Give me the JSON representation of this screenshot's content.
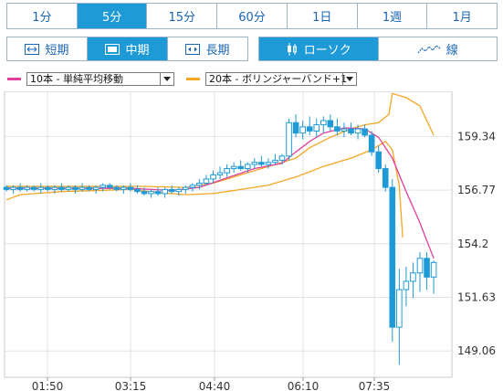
{
  "timeframes": [
    {
      "label": "1分",
      "active": false
    },
    {
      "label": "5分",
      "active": true
    },
    {
      "label": "15分",
      "active": false
    },
    {
      "label": "60分",
      "active": false
    },
    {
      "label": "1日",
      "active": false
    },
    {
      "label": "1週",
      "active": false
    },
    {
      "label": "1月",
      "active": false
    }
  ],
  "period_buttons": [
    {
      "label": "短期",
      "icon": "short-range-icon",
      "active": false
    },
    {
      "label": "中期",
      "icon": "mid-range-icon",
      "active": true
    },
    {
      "label": "長期",
      "icon": "long-range-icon",
      "active": false
    }
  ],
  "type_buttons": [
    {
      "label": "ローソク",
      "icon": "candlestick-icon",
      "active": true
    },
    {
      "label": "線",
      "icon": "line-chart-icon",
      "active": false
    }
  ],
  "indicators": [
    {
      "label": "10本 - 単純平均移動",
      "color": "#e0409a"
    },
    {
      "label": "20本 - ボリンジャーバンド+1",
      "color": "#f5a623"
    }
  ],
  "colors": {
    "accent": "#1e9ad6",
    "candle": "#1e9ad6",
    "ma": "#e0409a",
    "bollinger": "#f5a623"
  },
  "chart_data": {
    "type": "candlestick",
    "y_ticks": [
      159.34,
      156.77,
      154.2,
      151.63,
      149.06
    ],
    "ylim": [
      147.8,
      161.5
    ],
    "x_ticks": [
      "01:50",
      "03:15",
      "04:40",
      "06:10",
      "07:35"
    ],
    "grid": true,
    "candles": [
      [
        156.9,
        157.0,
        156.7,
        156.8
      ],
      [
        156.8,
        157.0,
        156.6,
        156.9
      ],
      [
        156.9,
        157.1,
        156.7,
        156.8
      ],
      [
        156.8,
        157.0,
        156.7,
        156.9
      ],
      [
        156.9,
        157.0,
        156.7,
        156.8
      ],
      [
        156.8,
        157.1,
        156.6,
        156.9
      ],
      [
        156.9,
        157.0,
        156.7,
        156.8
      ],
      [
        156.8,
        157.0,
        156.6,
        156.9
      ],
      [
        156.9,
        157.1,
        156.7,
        156.8
      ],
      [
        156.8,
        157.0,
        156.7,
        156.9
      ],
      [
        156.9,
        157.0,
        156.6,
        156.8
      ],
      [
        156.8,
        157.1,
        156.7,
        156.9
      ],
      [
        156.9,
        157.0,
        156.7,
        156.8
      ],
      [
        156.8,
        157.0,
        156.6,
        156.9
      ],
      [
        156.9,
        157.1,
        156.7,
        157.0
      ],
      [
        157.0,
        157.1,
        156.8,
        156.9
      ],
      [
        156.9,
        157.0,
        156.7,
        156.8
      ],
      [
        156.8,
        157.0,
        156.6,
        156.9
      ],
      [
        156.9,
        157.1,
        156.7,
        156.8
      ],
      [
        156.8,
        157.0,
        156.6,
        156.7
      ],
      [
        156.7,
        156.9,
        156.5,
        156.6
      ],
      [
        156.6,
        156.8,
        156.4,
        156.7
      ],
      [
        156.7,
        156.9,
        156.5,
        156.6
      ],
      [
        156.6,
        156.9,
        156.4,
        156.8
      ],
      [
        156.8,
        157.0,
        156.6,
        156.7
      ],
      [
        156.7,
        156.9,
        156.5,
        156.8
      ],
      [
        156.8,
        157.0,
        156.6,
        156.9
      ],
      [
        156.9,
        157.1,
        156.7,
        157.0
      ],
      [
        157.0,
        157.3,
        156.8,
        157.1
      ],
      [
        157.1,
        157.5,
        157.0,
        157.3
      ],
      [
        157.3,
        157.7,
        157.1,
        157.5
      ],
      [
        157.5,
        157.9,
        157.3,
        157.6
      ],
      [
        157.6,
        158.0,
        157.4,
        157.8
      ],
      [
        157.8,
        158.1,
        157.6,
        157.9
      ],
      [
        157.9,
        158.2,
        157.7,
        157.8
      ],
      [
        157.8,
        158.1,
        157.6,
        158.0
      ],
      [
        158.0,
        158.3,
        157.8,
        158.1
      ],
      [
        158.1,
        158.4,
        157.9,
        158.0
      ],
      [
        158.0,
        158.3,
        157.8,
        158.1
      ],
      [
        158.1,
        158.5,
        158.0,
        158.2
      ],
      [
        158.2,
        158.5,
        158.0,
        158.4
      ],
      [
        158.4,
        160.2,
        158.2,
        160.0
      ],
      [
        160.0,
        160.4,
        159.3,
        159.5
      ],
      [
        159.5,
        160.1,
        159.2,
        159.8
      ],
      [
        159.8,
        160.3,
        159.4,
        159.6
      ],
      [
        159.6,
        160.2,
        159.3,
        159.9
      ],
      [
        159.9,
        160.3,
        159.5,
        160.1
      ],
      [
        160.1,
        160.4,
        159.6,
        159.8
      ],
      [
        159.8,
        160.2,
        159.4,
        159.6
      ],
      [
        159.6,
        160.0,
        159.3,
        159.7
      ],
      [
        159.7,
        160.0,
        159.4,
        159.5
      ],
      [
        159.5,
        159.9,
        159.2,
        159.7
      ],
      [
        159.7,
        159.9,
        159.3,
        159.4
      ],
      [
        159.4,
        159.6,
        158.4,
        158.6
      ],
      [
        158.6,
        158.9,
        157.6,
        157.8
      ],
      [
        157.8,
        158.0,
        156.7,
        156.9
      ],
      [
        156.9,
        157.3,
        149.5,
        150.2
      ],
      [
        150.2,
        153.0,
        148.4,
        152.0
      ],
      [
        152.0,
        153.1,
        151.2,
        152.4
      ],
      [
        152.4,
        153.3,
        151.6,
        152.8
      ],
      [
        152.8,
        153.8,
        151.9,
        153.5
      ],
      [
        153.5,
        153.8,
        152.0,
        152.6
      ],
      [
        152.6,
        153.4,
        151.8,
        153.3
      ]
    ],
    "ma_10": [
      [
        0,
        156.85
      ],
      [
        18,
        156.85
      ],
      [
        24,
        156.75
      ],
      [
        28,
        156.9
      ],
      [
        32,
        157.35
      ],
      [
        36,
        157.8
      ],
      [
        40,
        158.05
      ],
      [
        42,
        158.6
      ],
      [
        44,
        159.1
      ],
      [
        46,
        159.5
      ],
      [
        49,
        159.75
      ],
      [
        52,
        159.7
      ],
      [
        54,
        159.3
      ],
      [
        56,
        158.3
      ],
      [
        58,
        156.7
      ],
      [
        60,
        155.2
      ],
      [
        62,
        153.5
      ]
    ],
    "bollinger_upper": [
      [
        0,
        156.95
      ],
      [
        20,
        156.95
      ],
      [
        26,
        156.9
      ],
      [
        30,
        157.1
      ],
      [
        34,
        157.5
      ],
      [
        38,
        157.9
      ],
      [
        42,
        158.3
      ],
      [
        44,
        158.8
      ],
      [
        47,
        159.3
      ],
      [
        50,
        159.7
      ],
      [
        52,
        159.9
      ],
      [
        54,
        160.0
      ],
      [
        55.5,
        160.4
      ],
      [
        56,
        161.4
      ],
      [
        58,
        161.2
      ],
      [
        60,
        160.8
      ],
      [
        62,
        159.4
      ]
    ],
    "bollinger_lower": [
      [
        0,
        156.3
      ],
      [
        2,
        156.55
      ],
      [
        8,
        156.7
      ],
      [
        18,
        156.8
      ],
      [
        22,
        156.65
      ],
      [
        26,
        156.55
      ],
      [
        30,
        156.6
      ],
      [
        34,
        156.8
      ],
      [
        38,
        157.0
      ],
      [
        42,
        157.4
      ],
      [
        46,
        157.9
      ],
      [
        50,
        158.3
      ],
      [
        53,
        158.7
      ],
      [
        55,
        159.1
      ],
      [
        56,
        158.7
      ],
      [
        57,
        157.0
      ],
      [
        57.5,
        154.5
      ]
    ]
  }
}
